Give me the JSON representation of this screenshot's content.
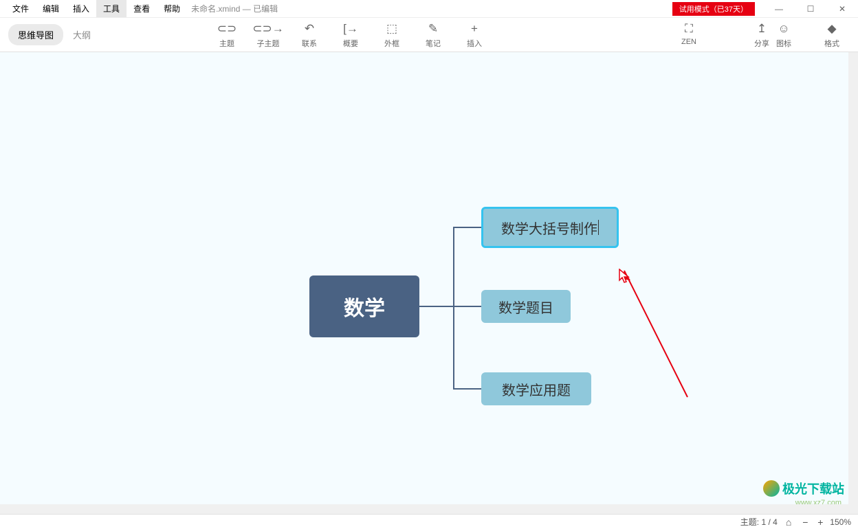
{
  "menu": {
    "items": [
      "文件",
      "编辑",
      "插入",
      "工具",
      "查看",
      "帮助"
    ],
    "activeIndex": 3
  },
  "fileStatus": "未命名.xmind  — 已编辑",
  "trialBadge": "试用模式（已37天）",
  "windowControls": {
    "min": "—",
    "max": "☐",
    "close": "✕"
  },
  "viewSwitch": {
    "mindmap": "思维导图",
    "outline": "大纲"
  },
  "tools": [
    {
      "icon": "⊂⊃",
      "label": "主题"
    },
    {
      "icon": "⊂⊃→",
      "label": "子主题"
    },
    {
      "icon": "↶",
      "label": "联系"
    },
    {
      "icon": "[→",
      "label": "概要"
    },
    {
      "icon": "⬚",
      "label": "外框"
    },
    {
      "icon": "✎",
      "label": "笔记"
    },
    {
      "icon": "+",
      "label": "插入"
    }
  ],
  "rightTools": [
    {
      "icon": "⛶",
      "label": "ZEN"
    },
    {
      "icon": "↥",
      "label": "分享"
    }
  ],
  "farRightTools": [
    {
      "icon": "☺",
      "label": "图标"
    },
    {
      "icon": "◆",
      "label": "格式"
    }
  ],
  "mindmap": {
    "root": "数学",
    "children": [
      "数学大括号制作",
      "数学题目",
      "数学应用题"
    ],
    "selectedIndex": 0
  },
  "status": {
    "topics": "主题: 1 / 4",
    "mapIcon": "⌂",
    "zoomOut": "−",
    "zoomIn": "+",
    "zoom": "150%"
  },
  "watermark": {
    "name": "极光下载站",
    "url": "www.xz7.com"
  }
}
